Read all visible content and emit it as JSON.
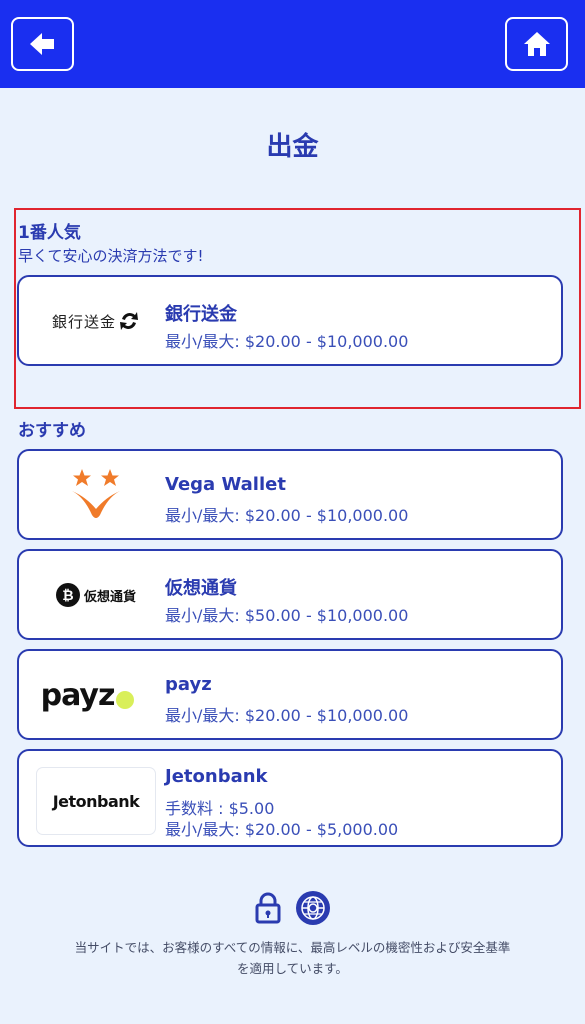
{
  "page": {
    "title": "出金"
  },
  "colors": {
    "header": "#1a2ff0",
    "accent": "#2a3bb0",
    "highlight": "#e0252f",
    "background": "#eaf2fd"
  },
  "icons": {
    "back": "arrow-left-icon",
    "home": "home-icon",
    "lock": "lock-icon",
    "globe": "globe-icon"
  },
  "popular": {
    "title": "1番人気",
    "subtitle": "早くて安心の決済方法です!",
    "items": [
      {
        "logo_text": "銀行送金",
        "name": "銀行送金",
        "limit": "最小/最大: $20.00 - $10,000.00"
      }
    ]
  },
  "recommended": {
    "title": "おすすめ",
    "items": [
      {
        "name": "Vega Wallet",
        "limit": "最小/最大: $20.00 - $10,000.00"
      },
      {
        "logo_text": "仮想通貨",
        "name": "仮想通貨",
        "limit": "最小/最大: $50.00 - $10,000.00"
      },
      {
        "logo_text": "payz",
        "name": "payz",
        "limit": "最小/最大: $20.00 - $10,000.00"
      },
      {
        "logo_text": "Jetonbank",
        "name": "Jetonbank",
        "fee": "手数料 : $5.00",
        "limit": "最小/最大: $20.00 - $5,000.00"
      }
    ]
  },
  "footer": {
    "text": "当サイトでは、お客様のすべての情報に、最高レベルの機密性および安全基準を適用しています。"
  }
}
